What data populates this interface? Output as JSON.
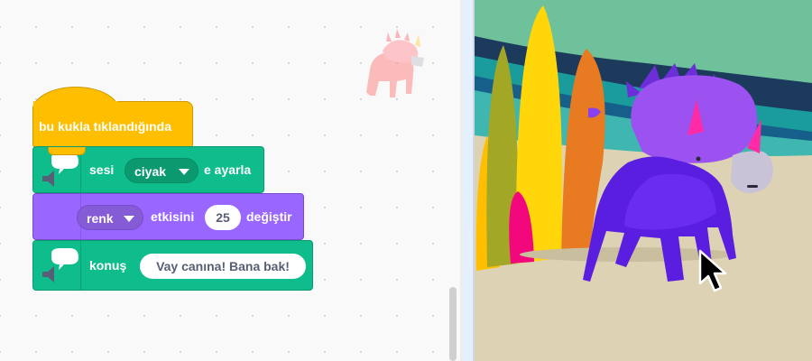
{
  "blocks": {
    "hat": {
      "label": "bu kukla tıklandığında"
    },
    "sound": {
      "prefix": "sesi",
      "sound_value": "ciyak",
      "suffix": "e ayarla"
    },
    "looks": {
      "effect_value": "renk",
      "middle": "etkisini",
      "amount": "25",
      "suffix": "değiştir"
    },
    "say": {
      "prefix": "konuş",
      "message": "Vay canına! Bana bak!"
    }
  },
  "icons": {
    "extension_icon": "speech-bubble-speaker-icon",
    "cursor": "mouse-pointer-icon",
    "sprite": "dinosaur-sprite"
  },
  "colors": {
    "events": "#ffbf00",
    "sound": "#0fbd8c",
    "looks": "#9966ff",
    "stage_sky": "#6fc19c",
    "stage_ground": "#ddd2b4",
    "dinosaur": "#8a3ff0"
  }
}
